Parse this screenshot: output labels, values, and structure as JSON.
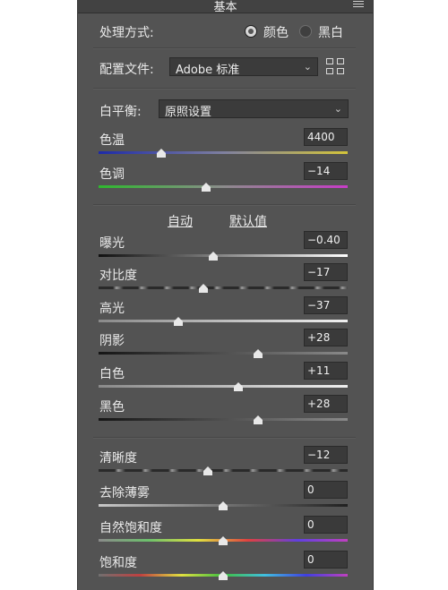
{
  "panel": {
    "title": "基本"
  },
  "treatment": {
    "label": "处理方式:",
    "options": [
      "颜色",
      "黑白"
    ],
    "selected": "颜色"
  },
  "profile": {
    "label": "配置文件:",
    "value": "Adobe 标准"
  },
  "white_balance": {
    "label": "白平衡:",
    "value": "原照设置"
  },
  "sliders": [
    {
      "id": "temp",
      "label": "色温",
      "value": "4400",
      "level": 0.25
    },
    {
      "id": "tint",
      "label": "色调",
      "value": "−14",
      "level": 0.43
    },
    {
      "id": "exposure",
      "label": "曝光",
      "value": "−0.40",
      "level": 0.46
    },
    {
      "id": "contrast",
      "label": "对比度",
      "value": "−17",
      "level": 0.42
    },
    {
      "id": "highlights",
      "label": "高光",
      "value": "−37",
      "level": 0.32
    },
    {
      "id": "shadows",
      "label": "阴影",
      "value": "+28",
      "level": 0.64
    },
    {
      "id": "whites",
      "label": "白色",
      "value": "+11",
      "level": 0.56
    },
    {
      "id": "blacks",
      "label": "黑色",
      "value": "+28",
      "level": 0.64
    },
    {
      "id": "clarity",
      "label": "清晰度",
      "value": "−12",
      "level": 0.44
    },
    {
      "id": "dehaze",
      "label": "去除薄雾",
      "value": "0",
      "level": 0.5
    },
    {
      "id": "vibrance",
      "label": "自然饱和度",
      "value": "0",
      "level": 0.5
    },
    {
      "id": "saturation",
      "label": "饱和度",
      "value": "0",
      "level": 0.5
    }
  ],
  "auto_label": "自动",
  "default_label": "默认值",
  "colors": {
    "panel": "#535353",
    "field": "#3a3a3a",
    "text": "#eaeaea"
  }
}
